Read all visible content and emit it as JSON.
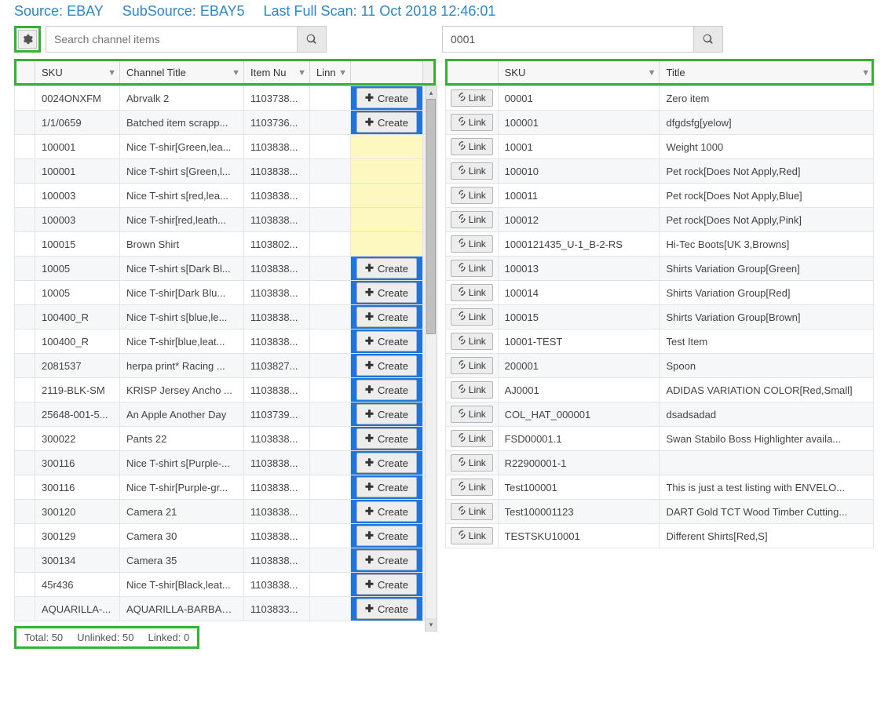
{
  "header": {
    "source_label": "Source:",
    "source_value": "EBAY",
    "subsource_label": "SubSource:",
    "subsource_value": "EBAY5",
    "lastscan_label": "Last Full Scan:",
    "lastscan_value": "11 Oct 2018 12:46:01"
  },
  "search_left": {
    "placeholder": "Search channel items",
    "value": ""
  },
  "search_right": {
    "placeholder": "",
    "value": "0001"
  },
  "left_grid": {
    "columns": {
      "sku": "SKU",
      "channel_title": "Channel Title",
      "item_number": "Item Nu",
      "linn": "Linn",
      "actions": ""
    },
    "create_label": "Create",
    "rows": [
      {
        "sku": "0024ONXFM",
        "title": "Abrvalk 2",
        "item": "1103738...",
        "create": "blue"
      },
      {
        "sku": "1/1/0659",
        "title": "Batched item scrapp...",
        "item": "1103736...",
        "create": "blue"
      },
      {
        "sku": "100001",
        "title": "Nice T-shir[Green,lea...",
        "item": "1103838...",
        "create": "yellow"
      },
      {
        "sku": "100001",
        "title": "Nice T-shirt s[Green,l...",
        "item": "1103838...",
        "create": "yellow"
      },
      {
        "sku": "100003",
        "title": "Nice T-shirt s[red,lea...",
        "item": "1103838...",
        "create": "yellow"
      },
      {
        "sku": "100003",
        "title": "Nice T-shir[red,leath...",
        "item": "1103838...",
        "create": "yellow"
      },
      {
        "sku": "100015",
        "title": "Brown Shirt",
        "item": "1103802...",
        "create": "yellow"
      },
      {
        "sku": "10005",
        "title": "Nice T-shirt s[Dark Bl...",
        "item": "1103838...",
        "create": "blue"
      },
      {
        "sku": "10005",
        "title": "Nice T-shir[Dark Blu...",
        "item": "1103838...",
        "create": "blue"
      },
      {
        "sku": "100400_R",
        "title": "Nice T-shirt s[blue,le...",
        "item": "1103838...",
        "create": "blue"
      },
      {
        "sku": "100400_R",
        "title": "Nice T-shir[blue,leat...",
        "item": "1103838...",
        "create": "blue"
      },
      {
        "sku": "2081537",
        "title": "herpa print* Racing ...",
        "item": "1103827...",
        "create": "blue"
      },
      {
        "sku": "2119-BLK-SM",
        "title": "KRISP Jersey Ancho ...",
        "item": "1103838...",
        "create": "blue"
      },
      {
        "sku": "25648-001-5...",
        "title": "An Apple Another Day",
        "item": "1103739...",
        "create": "blue"
      },
      {
        "sku": "300022",
        "title": "Pants 22",
        "item": "1103838...",
        "create": "blue"
      },
      {
        "sku": "300116",
        "title": "Nice T-shirt s[Purple-...",
        "item": "1103838...",
        "create": "blue"
      },
      {
        "sku": "300116",
        "title": "Nice T-shir[Purple-gr...",
        "item": "1103838...",
        "create": "blue"
      },
      {
        "sku": "300120",
        "title": "Camera 21",
        "item": "1103838...",
        "create": "blue"
      },
      {
        "sku": "300129",
        "title": "Camera 30",
        "item": "1103838...",
        "create": "blue"
      },
      {
        "sku": "300134",
        "title": "Camera 35",
        "item": "1103838...",
        "create": "blue"
      },
      {
        "sku": "45r436",
        "title": "Nice T-shir[Black,leat...",
        "item": "1103838...",
        "create": "blue"
      },
      {
        "sku": "AQUARILLA-...",
        "title": "AQUARILLA-BARBAD...",
        "item": "1103833...",
        "create": "blue"
      }
    ]
  },
  "right_grid": {
    "columns": {
      "link": "",
      "sku": "SKU",
      "title": "Title"
    },
    "link_label": "Link",
    "rows": [
      {
        "sku": "00001",
        "title": "Zero item"
      },
      {
        "sku": "100001",
        "title": "dfgdsfg[yelow]"
      },
      {
        "sku": "10001",
        "title": "Weight 1000"
      },
      {
        "sku": "100010",
        "title": "Pet rock[Does Not Apply,Red]"
      },
      {
        "sku": "100011",
        "title": "Pet rock[Does Not Apply,Blue]"
      },
      {
        "sku": "100012",
        "title": "Pet rock[Does Not Apply,Pink]"
      },
      {
        "sku": "1000121435_U-1_B-2-RS",
        "title": "Hi-Tec Boots[UK 3,Browns]"
      },
      {
        "sku": "100013",
        "title": "Shirts Variation Group[Green]"
      },
      {
        "sku": "100014",
        "title": "Shirts Variation Group[Red]"
      },
      {
        "sku": "100015",
        "title": "Shirts Variation Group[Brown]"
      },
      {
        "sku": "10001-TEST",
        "title": "Test Item"
      },
      {
        "sku": "200001",
        "title": "Spoon"
      },
      {
        "sku": "AJ0001",
        "title": "ADIDAS VARIATION COLOR[Red,Small]"
      },
      {
        "sku": "COL_HAT_000001",
        "title": "dsadsadad"
      },
      {
        "sku": "FSD00001.1",
        "title": "Swan Stabilo Boss Highlighter availa..."
      },
      {
        "sku": "R22900001-1",
        "title": ""
      },
      {
        "sku": "Test100001",
        "title": "This is just a test listing with ENVELO..."
      },
      {
        "sku": "Test100001123",
        "title": "DART Gold TCT Wood Timber Cutting..."
      },
      {
        "sku": "TESTSKU10001",
        "title": "Different Shirts[Red,S]"
      }
    ]
  },
  "footer": {
    "total_label": "Total:",
    "total_value": "50",
    "unlinked_label": "Unlinked:",
    "unlinked_value": "50",
    "linked_label": "Linked:",
    "linked_value": "0"
  }
}
